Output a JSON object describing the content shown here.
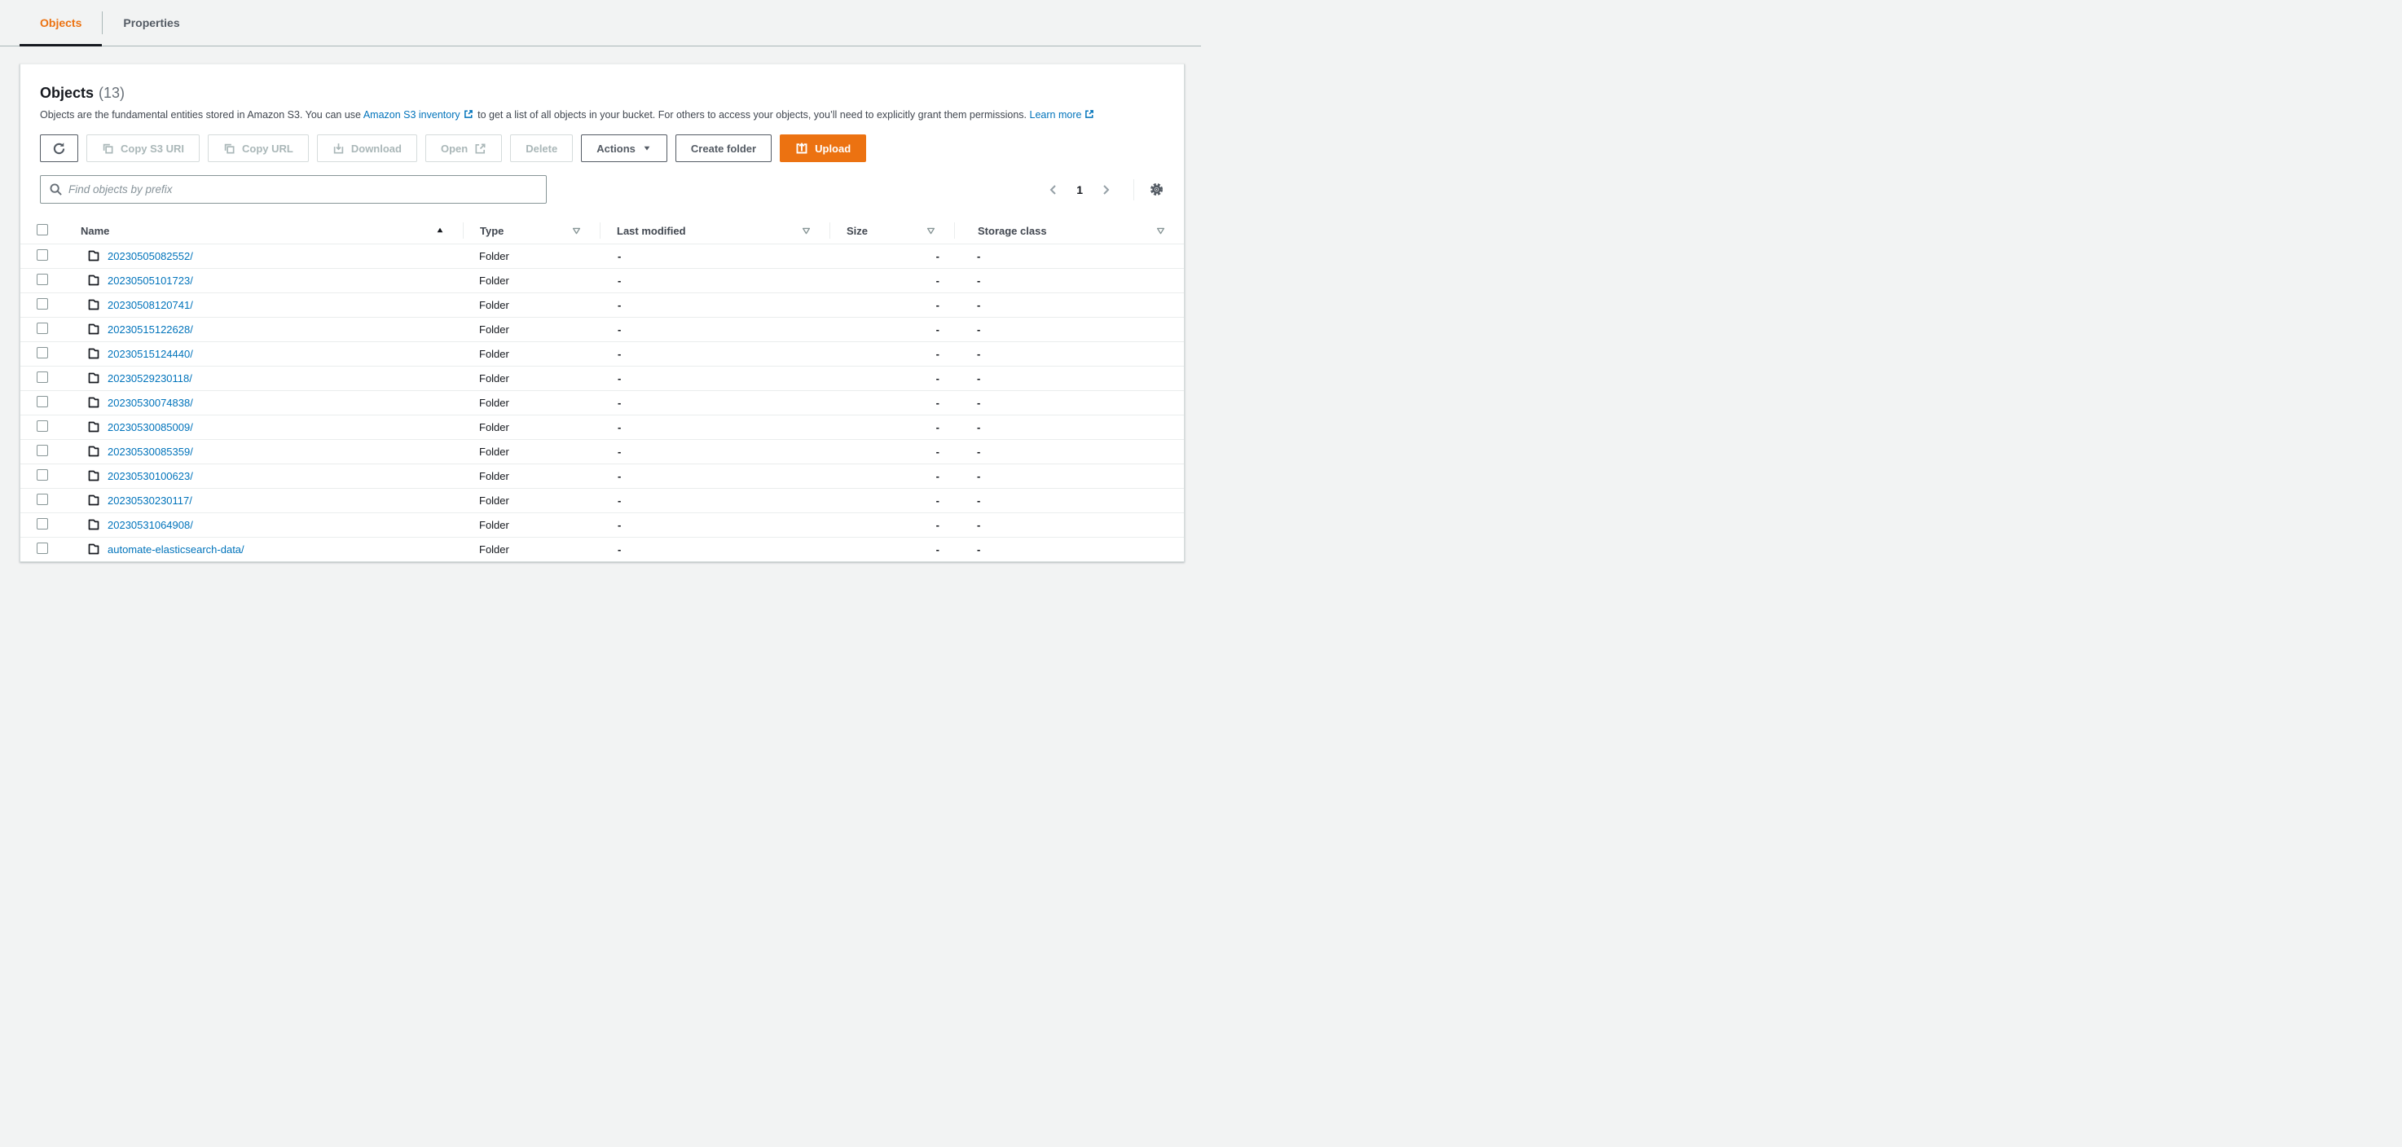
{
  "tabs": {
    "objects": "Objects",
    "properties": "Properties"
  },
  "header": {
    "title": "Objects",
    "count": "(13)",
    "description": {
      "pre": "Objects are the fundamental entities stored in Amazon S3. You can use",
      "inventory_link": "Amazon S3 inventory",
      "mid": "to get a list of all objects in your bucket. For others to access your objects, you’ll need to explicitly grant them permissions.",
      "learn_more_link": "Learn more"
    }
  },
  "toolbar": {
    "copy_s3_uri": "Copy S3 URI",
    "copy_url": "Copy URL",
    "download": "Download",
    "open": "Open",
    "delete": "Delete",
    "actions": "Actions",
    "create_folder": "Create folder",
    "upload": "Upload"
  },
  "search": {
    "placeholder": "Find objects by prefix"
  },
  "pagination": {
    "current_page": "1"
  },
  "table": {
    "columns": {
      "name": "Name",
      "type": "Type",
      "last_modified": "Last modified",
      "size": "Size",
      "storage_class": "Storage class"
    },
    "rows": [
      {
        "name": "20230505082552/",
        "type": "Folder",
        "last_modified": "-",
        "size": "-",
        "storage_class": "-"
      },
      {
        "name": "20230505101723/",
        "type": "Folder",
        "last_modified": "-",
        "size": "-",
        "storage_class": "-"
      },
      {
        "name": "20230508120741/",
        "type": "Folder",
        "last_modified": "-",
        "size": "-",
        "storage_class": "-"
      },
      {
        "name": "20230515122628/",
        "type": "Folder",
        "last_modified": "-",
        "size": "-",
        "storage_class": "-"
      },
      {
        "name": "20230515124440/",
        "type": "Folder",
        "last_modified": "-",
        "size": "-",
        "storage_class": "-"
      },
      {
        "name": "20230529230118/",
        "type": "Folder",
        "last_modified": "-",
        "size": "-",
        "storage_class": "-"
      },
      {
        "name": "20230530074838/",
        "type": "Folder",
        "last_modified": "-",
        "size": "-",
        "storage_class": "-"
      },
      {
        "name": "20230530085009/",
        "type": "Folder",
        "last_modified": "-",
        "size": "-",
        "storage_class": "-"
      },
      {
        "name": "20230530085359/",
        "type": "Folder",
        "last_modified": "-",
        "size": "-",
        "storage_class": "-"
      },
      {
        "name": "20230530100623/",
        "type": "Folder",
        "last_modified": "-",
        "size": "-",
        "storage_class": "-"
      },
      {
        "name": "20230530230117/",
        "type": "Folder",
        "last_modified": "-",
        "size": "-",
        "storage_class": "-"
      },
      {
        "name": "20230531064908/",
        "type": "Folder",
        "last_modified": "-",
        "size": "-",
        "storage_class": "-"
      },
      {
        "name": "automate-elasticsearch-data/",
        "type": "Folder",
        "last_modified": "-",
        "size": "-",
        "storage_class": "-"
      }
    ]
  },
  "colors": {
    "accent_orange": "#ec7211",
    "link_blue": "#0073bb",
    "active_tab_text": "#ec7211"
  }
}
